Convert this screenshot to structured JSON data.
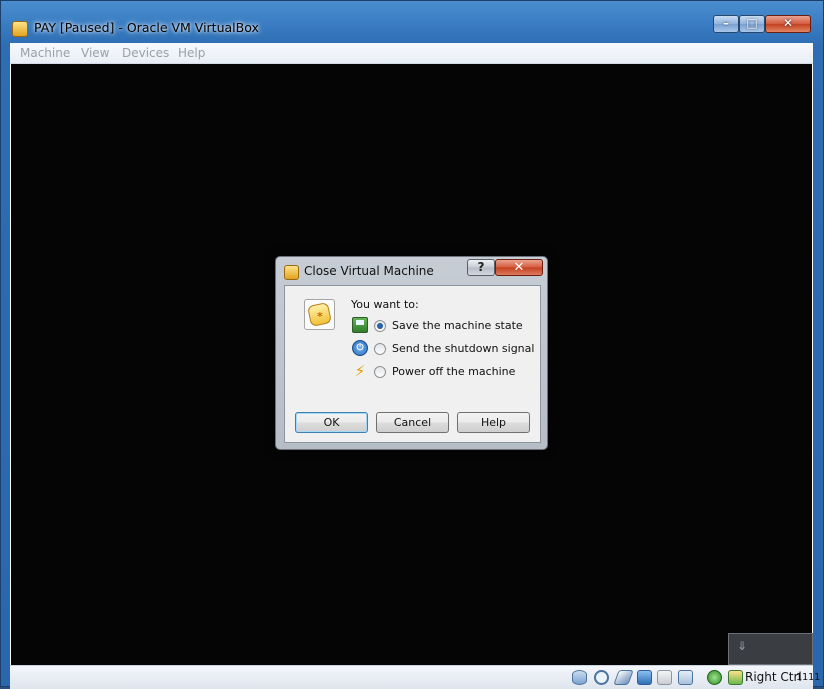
{
  "window": {
    "title": "PAY [Paused] - Oracle VM VirtualBox",
    "controls": {
      "minimize": "–",
      "maximize": "□",
      "close": "✕"
    }
  },
  "menubar": {
    "items": [
      "Machine",
      "View",
      "Devices",
      "Help"
    ]
  },
  "dialog": {
    "title": "Close Virtual Machine",
    "help_glyph": "?",
    "close_glyph": "✕",
    "prompt": "You want to:",
    "options": [
      {
        "label": "Save the machine state",
        "icon": "save-state-icon",
        "selected": true
      },
      {
        "label": "Send the shutdown signal",
        "icon": "power-icon",
        "selected": false
      },
      {
        "label": "Power off the machine",
        "icon": "lightning-icon",
        "selected": false
      }
    ],
    "buttons": {
      "ok": "OK",
      "cancel": "Cancel",
      "help": "Help"
    }
  },
  "statusbar": {
    "host_key": "Right Ctrl",
    "icons": [
      "hard-disk-icon",
      "optical-drive-icon",
      "usb-icon",
      "network-icon",
      "shared-folders-icon",
      "video-capture-icon",
      "virtualization-icon",
      "mouse-integration-icon"
    ]
  },
  "pinned_panel": {
    "label": "⇓"
  },
  "corner": {
    "text": "1111"
  },
  "colors": {
    "vm_screen": "#050505",
    "title_bar": "#3c7fc4",
    "close_button": "#c2401f"
  }
}
